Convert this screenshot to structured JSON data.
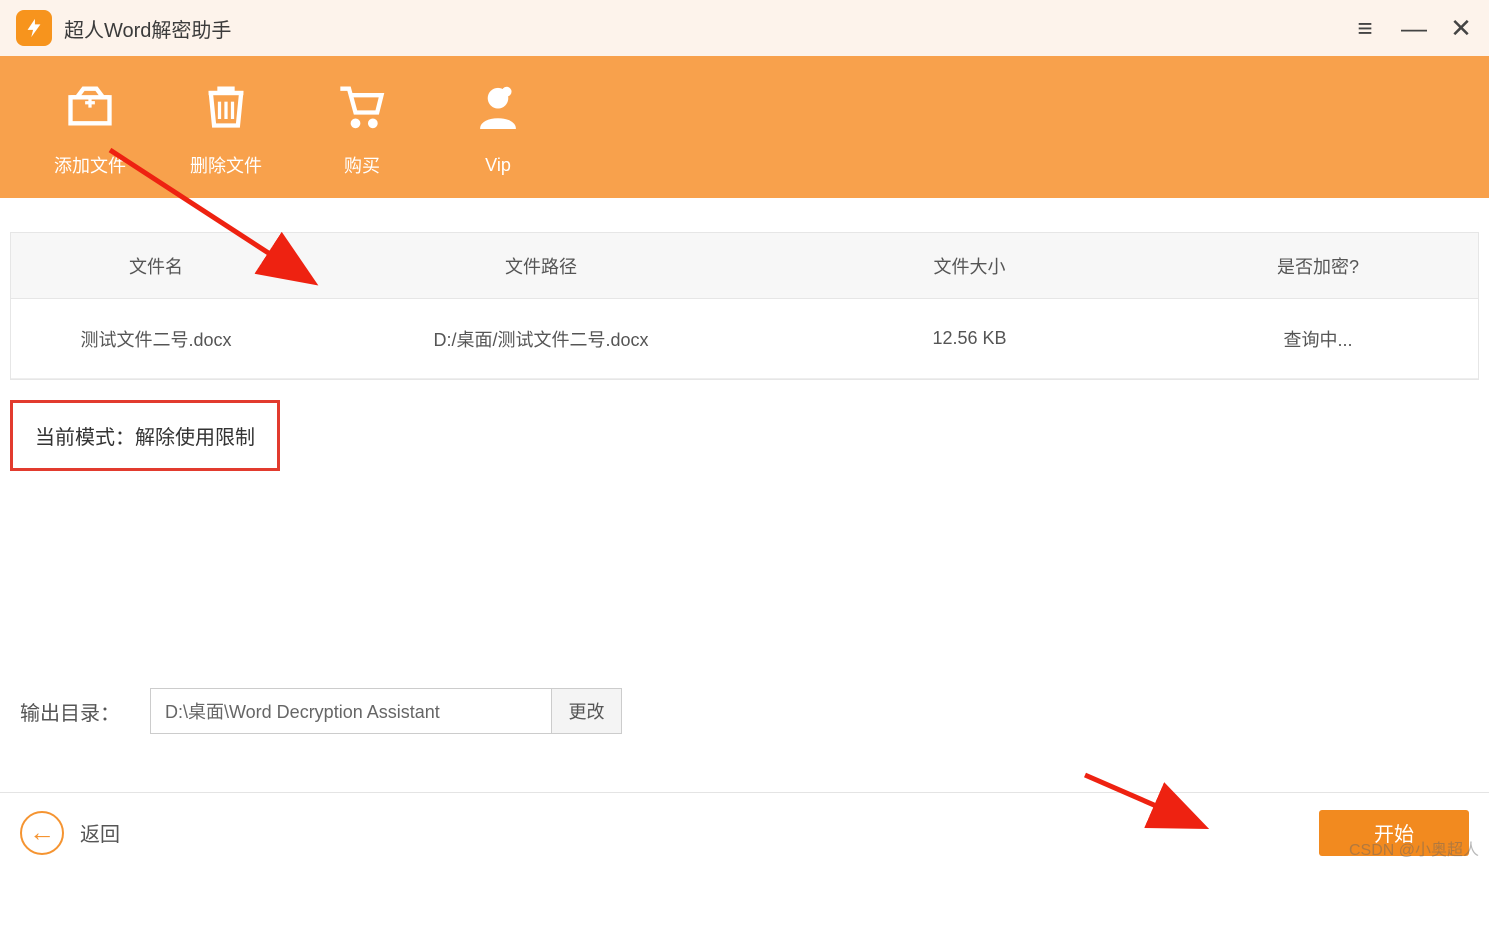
{
  "app": {
    "title": "超人Word解密助手"
  },
  "toolbar": {
    "add_file": "添加文件",
    "remove_file": "删除文件",
    "buy": "购买",
    "vip": "Vip"
  },
  "table": {
    "headers": {
      "name": "文件名",
      "path": "文件路径",
      "size": "文件大小",
      "encrypted": "是否加密?"
    },
    "rows": [
      {
        "name": "测试文件二号.docx",
        "path": "D:/桌面/测试文件二号.docx",
        "size": "12.56 KB",
        "encrypted": "查询中..."
      }
    ]
  },
  "mode": {
    "prefix": "当前模式：",
    "value": "解除使用限制"
  },
  "output": {
    "label": "输出目录：",
    "path": "D:\\桌面\\Word Decryption Assistant",
    "change": "更改"
  },
  "footer": {
    "back": "返回",
    "start": "开始"
  },
  "watermark": "CSDN @小奥超人"
}
